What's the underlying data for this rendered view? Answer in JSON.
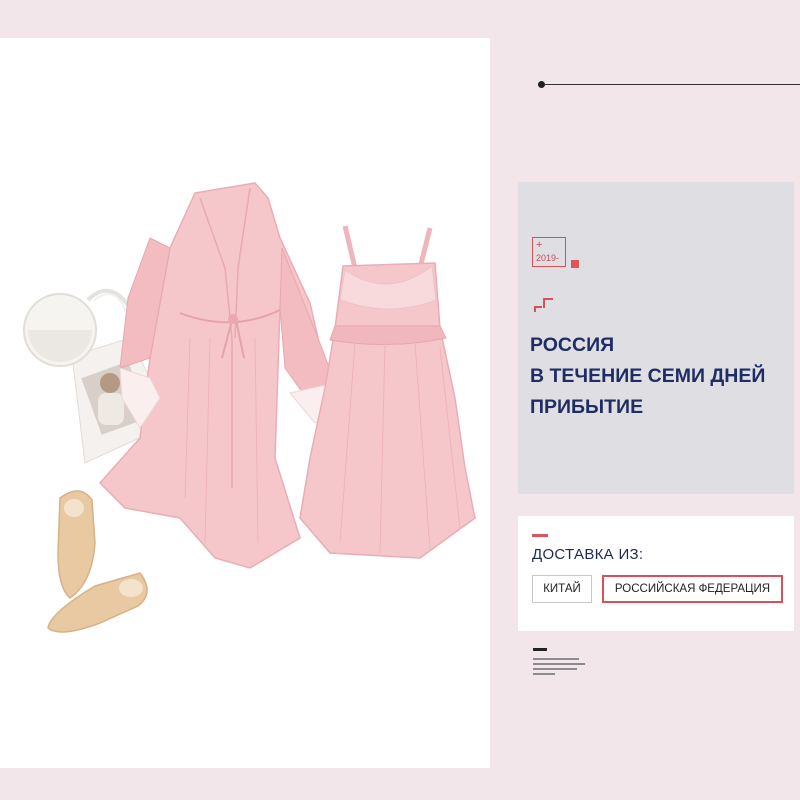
{
  "badge": {
    "plus": "+",
    "year": "2019-"
  },
  "headline": {
    "line1": "РОССИЯ",
    "line2": "В ТЕЧЕНИЕ СЕМИ ДНЕЙ",
    "line3": "ПРИБЫТИЕ"
  },
  "shipping": {
    "label": "ДОСТАВКА ИЗ:",
    "options": [
      "КИТАЙ",
      "РОССИЙСКАЯ ФЕДЕРАЦИЯ"
    ],
    "selected": "РОССИЙСКАЯ ФЕДЕРАЦИЯ"
  },
  "colors": {
    "accent": "#d9505a",
    "headline": "#1f2d64",
    "background": "#f2e6ea",
    "garment": "#f5c7cb"
  }
}
